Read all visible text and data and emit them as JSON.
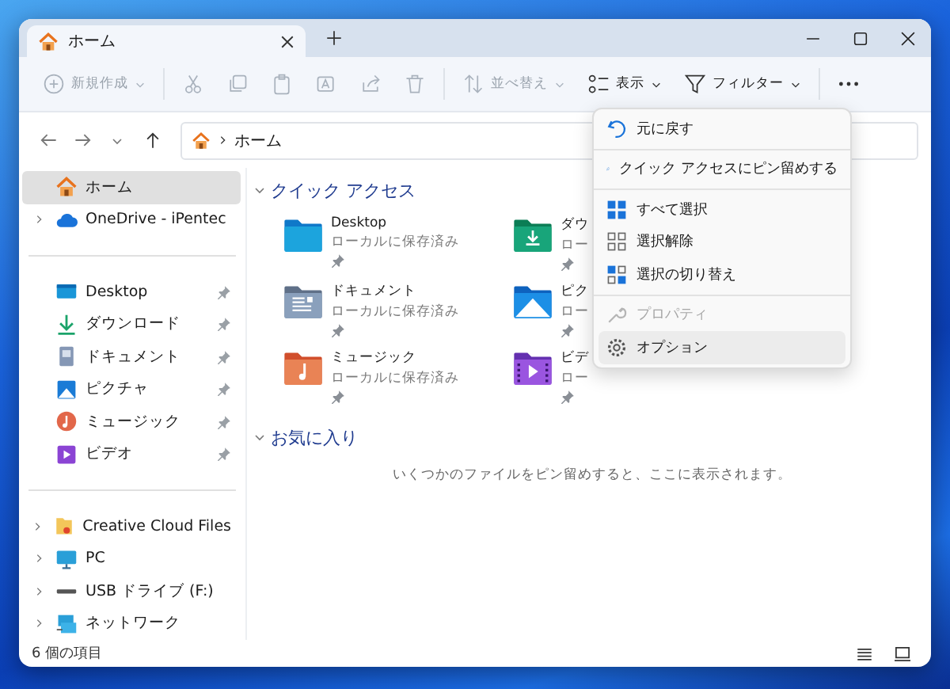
{
  "window": {
    "tabs": [
      {
        "label": "ホーム",
        "selected": true
      }
    ]
  },
  "toolbar": {
    "items": [
      {
        "kind": "new",
        "label": "新規作成",
        "disabled": true
      },
      {
        "kind": "cut",
        "disabled": true
      },
      {
        "kind": "copy",
        "disabled": true
      },
      {
        "kind": "paste",
        "disabled": true
      },
      {
        "kind": "rename",
        "disabled": true
      },
      {
        "kind": "share",
        "disabled": true
      },
      {
        "kind": "delete",
        "disabled": true
      },
      {
        "kind": "sort",
        "label": "並べ替え",
        "disabled": true
      },
      {
        "kind": "view",
        "label": "表示",
        "disabled": false
      },
      {
        "kind": "filter",
        "label": "フィルター",
        "disabled": false
      },
      {
        "kind": "more",
        "disabled": false
      }
    ]
  },
  "address": {
    "path": [
      "ホーム"
    ]
  },
  "sidebar": {
    "sections": [
      [
        {
          "kind": "home",
          "label": "ホーム",
          "selected": true,
          "expandable": false,
          "pinned": false
        },
        {
          "kind": "onedrive",
          "label": "OneDrive - iPentec",
          "selected": false,
          "expandable": true,
          "pinned": false
        }
      ],
      [
        {
          "kind": "desktop",
          "label": "Desktop",
          "selected": false,
          "expandable": false,
          "pinned": true
        },
        {
          "kind": "download",
          "label": "ダウンロード",
          "selected": false,
          "expandable": false,
          "pinned": true
        },
        {
          "kind": "documents",
          "label": "ドキュメント",
          "selected": false,
          "expandable": false,
          "pinned": true
        },
        {
          "kind": "pictures",
          "label": "ピクチャ",
          "selected": false,
          "expandable": false,
          "pinned": true
        },
        {
          "kind": "music",
          "label": "ミュージック",
          "selected": false,
          "expandable": false,
          "pinned": true
        },
        {
          "kind": "videos",
          "label": "ビデオ",
          "selected": false,
          "expandable": false,
          "pinned": true
        }
      ],
      [
        {
          "kind": "cloud",
          "label": "Creative Cloud Files",
          "selected": false,
          "expandable": true,
          "pinned": false
        },
        {
          "kind": "pc",
          "label": "PC",
          "selected": false,
          "expandable": true,
          "pinned": false
        },
        {
          "kind": "usb",
          "label": "USB ドライブ (F:)",
          "selected": false,
          "expandable": true,
          "pinned": false
        },
        {
          "kind": "network",
          "label": "ネットワーク",
          "selected": false,
          "expandable": true,
          "pinned": false
        }
      ]
    ]
  },
  "content": {
    "sections": [
      {
        "title": "クイック アクセス",
        "expanded": true,
        "items": [
          {
            "kind": "desktop",
            "name": "Desktop",
            "subtitle": "ローカルに保存済み",
            "pinned": true
          },
          {
            "kind": "download",
            "name": "ダウ",
            "subtitle": "ロー",
            "pinned": true
          },
          {
            "kind": "documents",
            "name": "ドキュメント",
            "subtitle": "ローカルに保存済み",
            "pinned": true
          },
          {
            "kind": "pictures",
            "name": "ピク",
            "subtitle": "ロー",
            "pinned": true
          },
          {
            "kind": "music",
            "name": "ミュージック",
            "subtitle": "ローカルに保存済み",
            "pinned": true
          },
          {
            "kind": "videos",
            "name": "ビデ",
            "subtitle": "ロー",
            "pinned": true
          }
        ]
      },
      {
        "title": "お気に入り",
        "expanded": true,
        "empty_text": "いくつかのファイルをピン留めすると、ここに表示されます。"
      }
    ]
  },
  "menu": {
    "groups": [
      [
        {
          "kind": "undo",
          "label": "元に戻す",
          "disabled": false,
          "selected": false
        }
      ],
      [
        {
          "kind": "pin",
          "label": "クイック アクセスにピン留めする",
          "disabled": false,
          "selected": false
        }
      ],
      [
        {
          "kind": "select-all",
          "label": "すべて選択",
          "disabled": false,
          "selected": false
        },
        {
          "kind": "select-none",
          "label": "選択解除",
          "disabled": false,
          "selected": false
        },
        {
          "kind": "invert",
          "label": "選択の切り替え",
          "disabled": false,
          "selected": false
        }
      ],
      [
        {
          "kind": "properties",
          "label": "プロパティ",
          "disabled": true,
          "selected": false
        },
        {
          "kind": "options",
          "label": "オプション",
          "disabled": false,
          "selected": true
        }
      ]
    ]
  },
  "status_bar": {
    "count": "6 個の項目"
  }
}
